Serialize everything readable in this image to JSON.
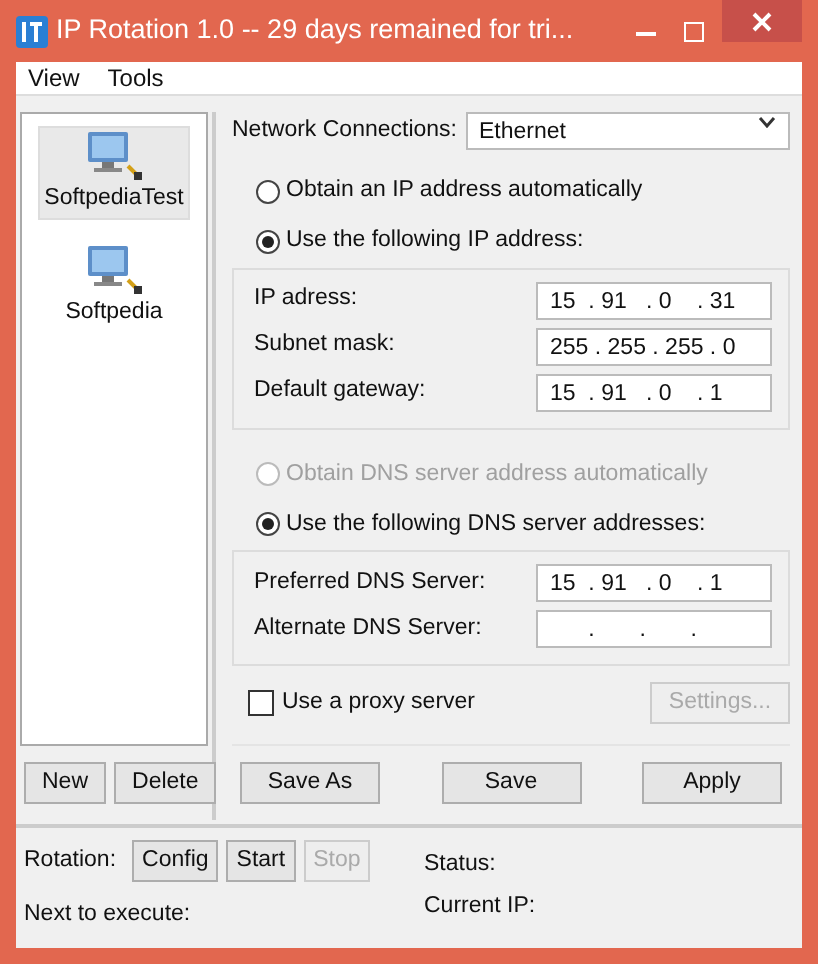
{
  "window": {
    "title": "IP Rotation 1.0   --  29 days remained for tri..."
  },
  "menu": [
    "View",
    "Tools"
  ],
  "profiles": [
    {
      "label": "SoftpediaTest",
      "selected": true
    },
    {
      "label": "Softpedia",
      "selected": false
    }
  ],
  "profile_buttons": [
    "New",
    "Delete"
  ],
  "network": {
    "label": "Network Connections:",
    "value": "Ethernet"
  },
  "ip_options": [
    {
      "label": "Obtain an IP address automatically",
      "selected": false,
      "disabled": false
    },
    {
      "label": "Use the following IP address:",
      "selected": true,
      "disabled": false
    }
  ],
  "ip_fields": [
    {
      "label": "IP adress:",
      "value": "15  . 91   . 0    . 31"
    },
    {
      "label": "Subnet mask:",
      "value": "255 . 255 . 255 . 0"
    },
    {
      "label": "Default gateway:",
      "value": "15  . 91   . 0    . 1"
    }
  ],
  "dns_options": [
    {
      "label": "Obtain DNS server address automatically",
      "selected": false,
      "disabled": true
    },
    {
      "label": "Use the following DNS server addresses:",
      "selected": true,
      "disabled": false
    }
  ],
  "dns_fields": [
    {
      "label": "Preferred DNS Server:",
      "value": "15  . 91   . 0    . 1"
    },
    {
      "label": "Alternate DNS Server:",
      "value": "      .       .       ."
    }
  ],
  "proxy": {
    "label": "Use a proxy server",
    "checked": false,
    "settings": {
      "label": "Settings...",
      "disabled": true
    }
  },
  "config_buttons": [
    "Save As",
    "Save",
    "Apply"
  ],
  "rotation": {
    "label": "Rotation:",
    "buttons": [
      {
        "label": "Config",
        "disabled": false
      },
      {
        "label": "Start",
        "disabled": false
      },
      {
        "label": "Stop",
        "disabled": true
      }
    ],
    "next": "Next to execute:"
  },
  "status": {
    "status": "Status:",
    "current_ip": "Current IP:"
  }
}
